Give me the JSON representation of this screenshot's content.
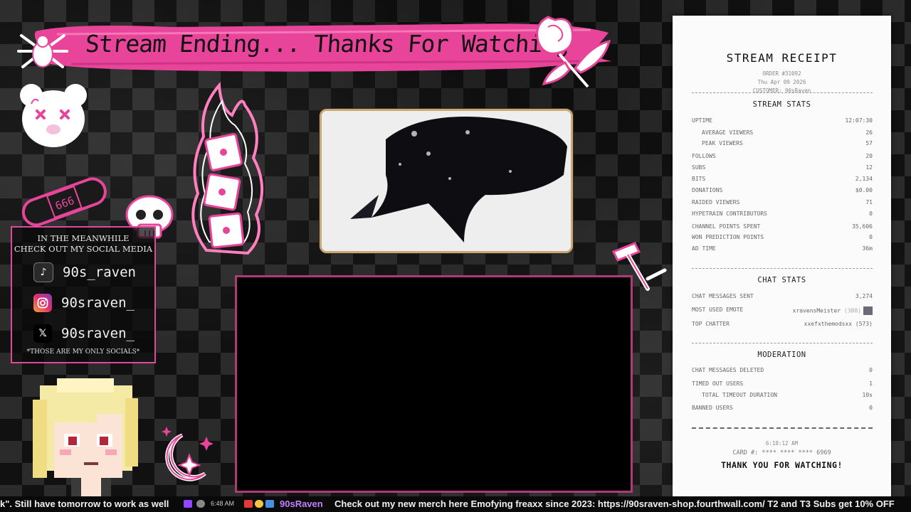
{
  "banner": {
    "title": "Stream Ending... Thanks For Watching"
  },
  "social": {
    "heading_line1": "IN THE MEANWHILE",
    "heading_line2": "CHECK OUT MY SOCIAL MEDIA",
    "items": [
      {
        "platform": "tiktok-icon",
        "handle": "90s_raven"
      },
      {
        "platform": "instagram-icon",
        "handle": "90sraven_"
      },
      {
        "platform": "x-icon",
        "handle": "90sraven_"
      }
    ],
    "footnote": "*THOSE ARE MY ONLY SOCIALS*"
  },
  "stickers": {
    "bandage_text": "666"
  },
  "receipt": {
    "title": "STREAM RECEIPT",
    "order": "ORDER #31092",
    "date": "Thu Apr 09 2026",
    "customer": "CUSTOMER: 90sRaven",
    "stream_stats_title": "STREAM STATS",
    "stream_stats": [
      {
        "label": "UPTIME",
        "value": "12:07:30",
        "indent": false
      },
      {
        "label": "AVERAGE VIEWERS",
        "value": "26",
        "indent": true
      },
      {
        "label": "PEAK VIEWERS",
        "value": "57",
        "indent": true
      },
      {
        "label": "FOLLOWS",
        "value": "20",
        "indent": false
      },
      {
        "label": "SUBS",
        "value": "12",
        "indent": false
      },
      {
        "label": "BITS",
        "value": "2,134",
        "indent": false
      },
      {
        "label": "DONATIONS",
        "value": "$0.00",
        "indent": false
      },
      {
        "label": "RAIDED VIEWERS",
        "value": "71",
        "indent": false
      },
      {
        "label": "HYPETRAIN CONTRIBUTORS",
        "value": "0",
        "indent": false
      },
      {
        "label": "CHANNEL POINTS SPENT",
        "value": "35,606",
        "indent": false
      },
      {
        "label": "WON PREDICTION POINTS",
        "value": "0",
        "indent": false
      },
      {
        "label": "AD TIME",
        "value": "36m",
        "indent": false
      }
    ],
    "chat_stats_title": "CHAT STATS",
    "chat_stats": {
      "messages_label": "CHAT MESSAGES SENT",
      "messages_value": "3,274",
      "emote_label": "MOST USED EMOTE",
      "emote_name": "xravensMeister",
      "emote_count": "(388)",
      "chatter_label": "TOP CHATTER",
      "chatter_value": "xxefxthemodsxx (573)"
    },
    "moderation_title": "MODERATION",
    "moderation": [
      {
        "label": "CHAT MESSAGES DELETED",
        "value": "0",
        "indent": false
      },
      {
        "label": "TIMED OUT USERS",
        "value": "1",
        "indent": false
      },
      {
        "label": "TOTAL TIMEOUT DURATION",
        "value": "10s",
        "indent": true
      },
      {
        "label": "BANNED USERS",
        "value": "0",
        "indent": false
      }
    ],
    "print_time": "6:18:12 AM",
    "card": "CARD #: **** **** **** 6969",
    "thanks": "THANK YOU FOR WATCHING!"
  },
  "ticker": {
    "prev_message": "k\". Still have tomorrow to work as well",
    "time": "6:48 AM",
    "username": "90sRaven",
    "message": "Check out my new merch here Emofying freaxx since 2023: https://90sraven-shop.fourthwall.com/ T2 and T3 Subs get 10% OFF"
  },
  "colors": {
    "accent_pink": "#e8449a",
    "receipt_bg": "#fbfbfb",
    "username": "#c77dff"
  }
}
